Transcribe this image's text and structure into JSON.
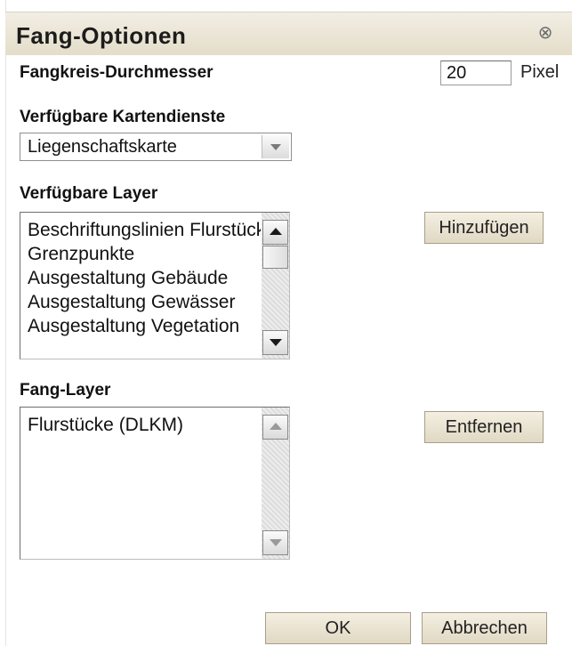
{
  "dialog": {
    "title": "Fang-Optionen",
    "close_glyph": "⊗"
  },
  "snap_radius": {
    "label": "Fangkreis-Durchmesser",
    "value": "20",
    "unit": "Pixel"
  },
  "map_services": {
    "label": "Verfügbare Kartendienste",
    "selected": "Liegenschaftskarte"
  },
  "available_layers": {
    "label": "Verfügbare Layer",
    "items": [
      "Beschriftungslinien Flurstücke",
      "Grenzpunkte",
      "Ausgestaltung Gebäude",
      "Ausgestaltung Gewässer",
      "Ausgestaltung Vegetation"
    ],
    "add_button": "Hinzufügen"
  },
  "snap_layers": {
    "label": "Fang-Layer",
    "items": [
      "Flurstücke (DLKM)"
    ],
    "remove_button": "Entfernen"
  },
  "footer": {
    "ok": "OK",
    "cancel": "Abbrechen"
  }
}
